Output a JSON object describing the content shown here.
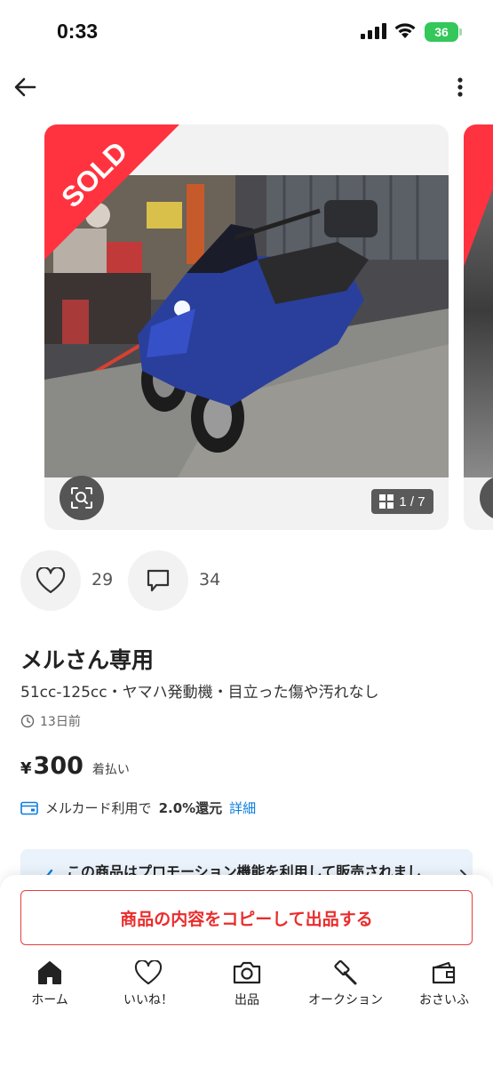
{
  "status_bar": {
    "time": "0:33",
    "battery": "36"
  },
  "nav": {
    "back_icon": "arrow-left-icon",
    "more_icon": "more-vertical-icon"
  },
  "gallery": {
    "sold_label": "SOLD",
    "counter": "1 / 7",
    "sold_color": "#ff333f"
  },
  "engagement": {
    "likes": "29",
    "comments": "34"
  },
  "item": {
    "title": "メルさん専用",
    "subtitle": "51cc-125cc・ヤマハ発動機・目立った傷や汚れなし",
    "posted": "13日前",
    "price_symbol": "¥",
    "price": "300",
    "shipping": "着払い"
  },
  "merpay": {
    "prefix": "メルカード利用で",
    "rate": "2.0%還元",
    "link": "詳細"
  },
  "promotion": {
    "text": "この商品はプロモーション機能を利用して販売されまし"
  },
  "actions": {
    "copy_listing": "商品の内容をコピーして出品する"
  },
  "tabbar": {
    "items": [
      {
        "label": "ホーム",
        "icon": "home-icon"
      },
      {
        "label": "いいね！",
        "icon": "heart-icon"
      },
      {
        "label": "出品",
        "icon": "camera-icon"
      },
      {
        "label": "オークション",
        "icon": "gavel-icon"
      },
      {
        "label": "おさいふ",
        "icon": "wallet-icon"
      }
    ]
  },
  "colors": {
    "accent_red": "#ea2c2c",
    "link_blue": "#0a7ee0",
    "battery_green": "#34c759"
  }
}
